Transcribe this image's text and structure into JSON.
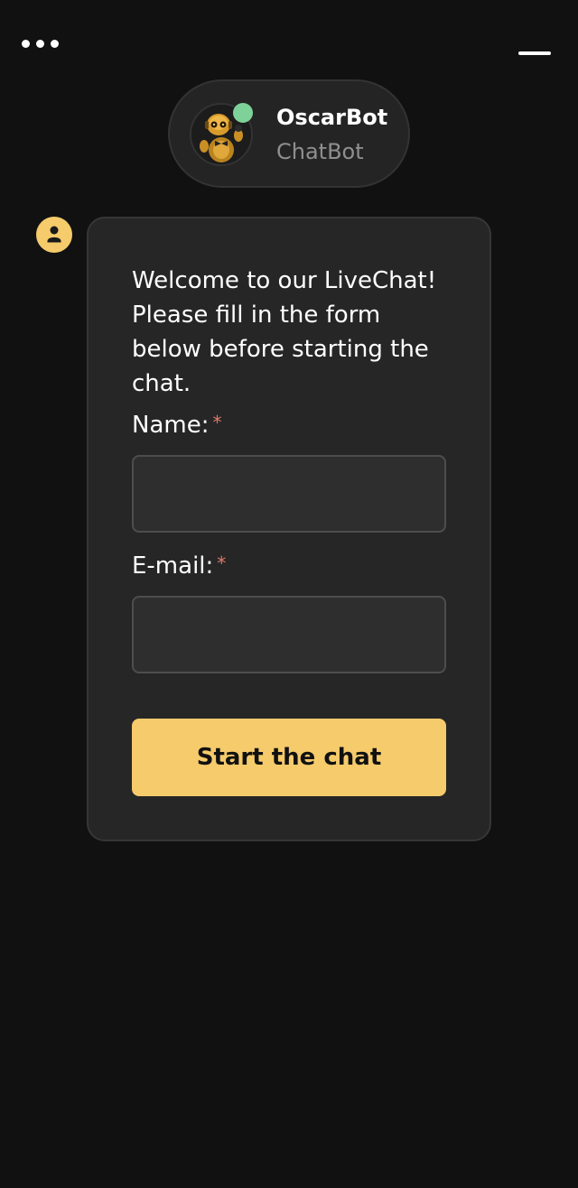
{
  "header": {
    "menu_icon": "more-dots-icon",
    "minimize_icon": "minimize-icon"
  },
  "bot": {
    "name": "OscarBot",
    "role": "ChatBot",
    "status_color": "#7fd19a",
    "avatar_icon": "robot-avatar"
  },
  "message": {
    "text": "Welcome to our LiveChat! Please fill in the form below before starting the chat."
  },
  "form": {
    "name_label": "Name:",
    "name_value": "",
    "email_label": "E-mail:",
    "email_value": "",
    "required_mark": "*",
    "submit_label": "Start the chat"
  },
  "colors": {
    "background": "#111111",
    "card": "#262626",
    "accent": "#f5cb6b",
    "required": "#e07a6a",
    "online": "#7fd19a"
  }
}
